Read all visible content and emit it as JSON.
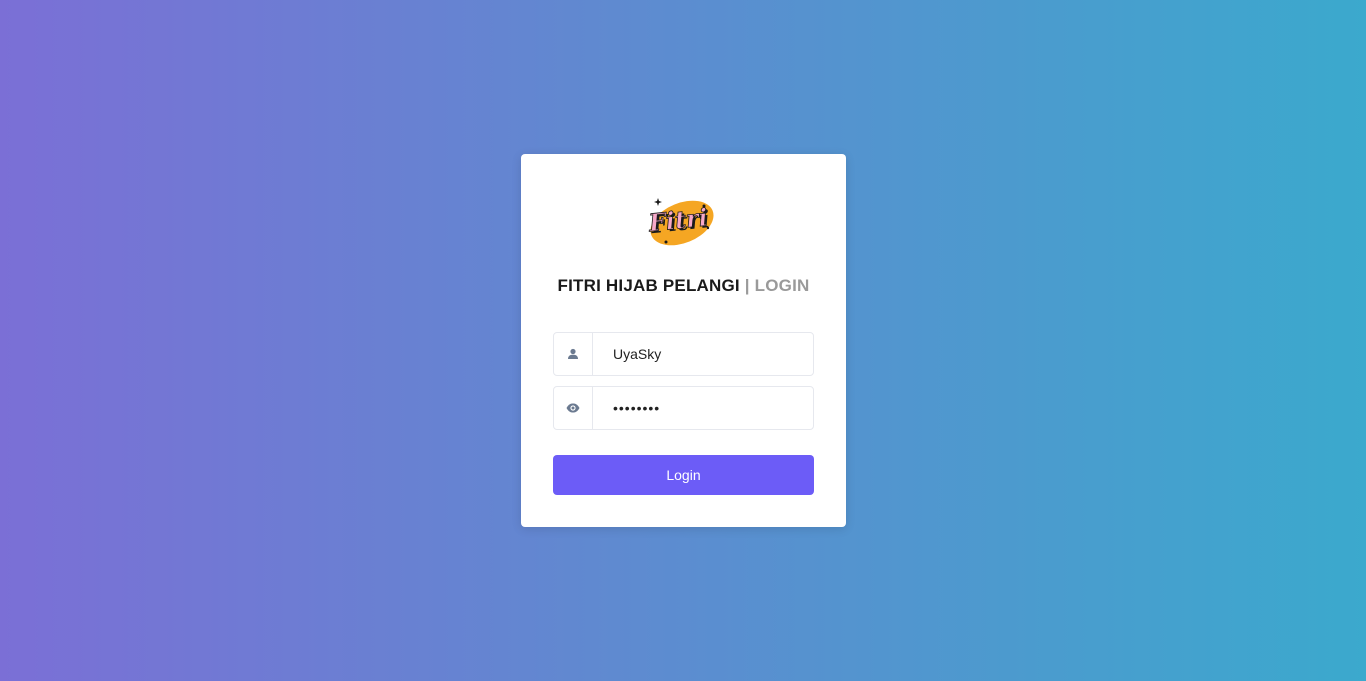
{
  "brand": {
    "logo_text": "Fitri",
    "title_main": "FITRI HIJAB PELANGI",
    "title_sep": "| LOGIN"
  },
  "form": {
    "username": {
      "value": "UyaSky",
      "icon": "user-icon"
    },
    "password": {
      "value": "uyasky12",
      "icon": "eye-icon"
    },
    "login_label": "Login"
  },
  "colors": {
    "gradient_start": "#7b6fd6",
    "gradient_end": "#3ba9cd",
    "button": "#6c5cf7",
    "logo_orange": "#f5a623",
    "logo_pink": "#f7a8c8"
  }
}
